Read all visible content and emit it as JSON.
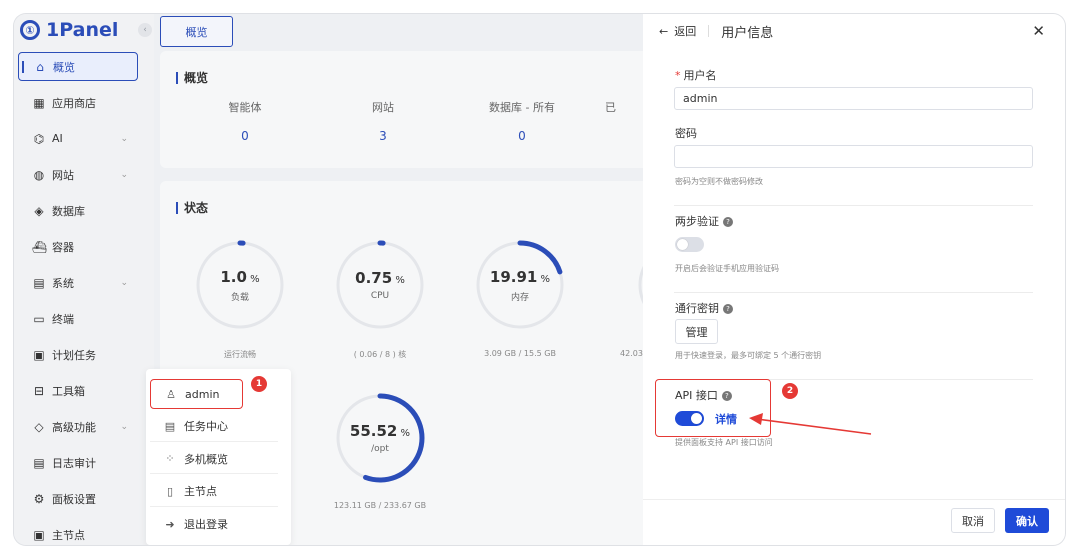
{
  "logo": {
    "text": "1Panel",
    "mark": "①"
  },
  "sidebar": {
    "items": [
      {
        "label": "概览",
        "icon": "home-icon",
        "glyph": "⌂"
      },
      {
        "label": "应用商店",
        "icon": "grid-icon",
        "glyph": "▦"
      },
      {
        "label": "AI",
        "icon": "robot-icon",
        "glyph": "⌬"
      },
      {
        "label": "网站",
        "icon": "globe-icon",
        "glyph": "◍"
      },
      {
        "label": "数据库",
        "icon": "layers-icon",
        "glyph": "◈"
      },
      {
        "label": "容器",
        "icon": "docker-icon",
        "glyph": "⛴"
      },
      {
        "label": "系统",
        "icon": "system-icon",
        "glyph": "▤"
      },
      {
        "label": "终端",
        "icon": "terminal-icon",
        "glyph": "▭"
      },
      {
        "label": "计划任务",
        "icon": "calendar-icon",
        "glyph": "▣"
      },
      {
        "label": "工具箱",
        "icon": "toolbox-icon",
        "glyph": "⊟"
      },
      {
        "label": "高级功能",
        "icon": "diamond-icon",
        "glyph": "◇"
      },
      {
        "label": "日志审计",
        "icon": "log-icon",
        "glyph": "▤"
      },
      {
        "label": "面板设置",
        "icon": "gear-icon",
        "glyph": "⚙"
      },
      {
        "label": "主节点",
        "icon": "node-icon",
        "glyph": "▣"
      }
    ]
  },
  "topbar": {
    "tab": "概览"
  },
  "overview": {
    "title": "概览",
    "stats": [
      {
        "label": "智能体",
        "value": "0"
      },
      {
        "label": "网站",
        "value": "3"
      },
      {
        "label": "数据库 - 所有",
        "value": "0"
      },
      {
        "label": "已",
        "value": ""
      }
    ]
  },
  "status": {
    "title": "状态",
    "gauges": [
      {
        "value": "1.0",
        "unit": " %",
        "label": "负载",
        "sub": "运行流畅",
        "percent": 1
      },
      {
        "value": "0.75",
        "unit": " %",
        "label": "CPU",
        "sub": "( 0.06 / 8 ) 核",
        "percent": 0.75
      },
      {
        "value": "19.91",
        "unit": " %",
        "label": "内存",
        "sub": "3.09 GB / 15.5 GB",
        "percent": 19.91
      },
      {
        "value": "55.52",
        "unit": " %",
        "label": "/opt",
        "sub": "123.11 GB / 233.67 GB",
        "percent": 55.52
      }
    ],
    "partial_sub": "42.03"
  },
  "user_menu": {
    "items": [
      {
        "label": "admin",
        "icon": "user-icon",
        "glyph": "♙"
      },
      {
        "label": "任务中心",
        "icon": "task-icon",
        "glyph": "▤"
      },
      {
        "label": "多机概览",
        "icon": "multi-icon",
        "glyph": "⁘"
      },
      {
        "label": "主节点",
        "icon": "server-icon",
        "glyph": "▯"
      },
      {
        "label": "退出登录",
        "icon": "logout-icon",
        "glyph": "➜"
      }
    ],
    "badge": "1"
  },
  "drawer": {
    "back": "返回",
    "title": "用户信息",
    "username_label": "用户名",
    "username_value": "admin",
    "password_label": "密码",
    "password_value": "",
    "password_hint": "密码为空则不做密码修改",
    "mfa_label": "两步验证",
    "mfa_hint": "开启后会验证手机应用验证码",
    "mfa_enabled": false,
    "passkey_label": "通行密钥",
    "passkey_button": "管理",
    "passkey_hint": "用于快速登录，最多可绑定 5 个通行密钥",
    "api_label": "API 接口",
    "api_enabled": true,
    "api_detail": "详情",
    "api_hint": "提供面板支持 API 接口访问",
    "badge": "2",
    "cancel": "取消",
    "confirm": "确认"
  },
  "colors": {
    "accent": "#2b4db8",
    "annotation": "#e53935",
    "toggle_on": "#1f4bd8"
  }
}
